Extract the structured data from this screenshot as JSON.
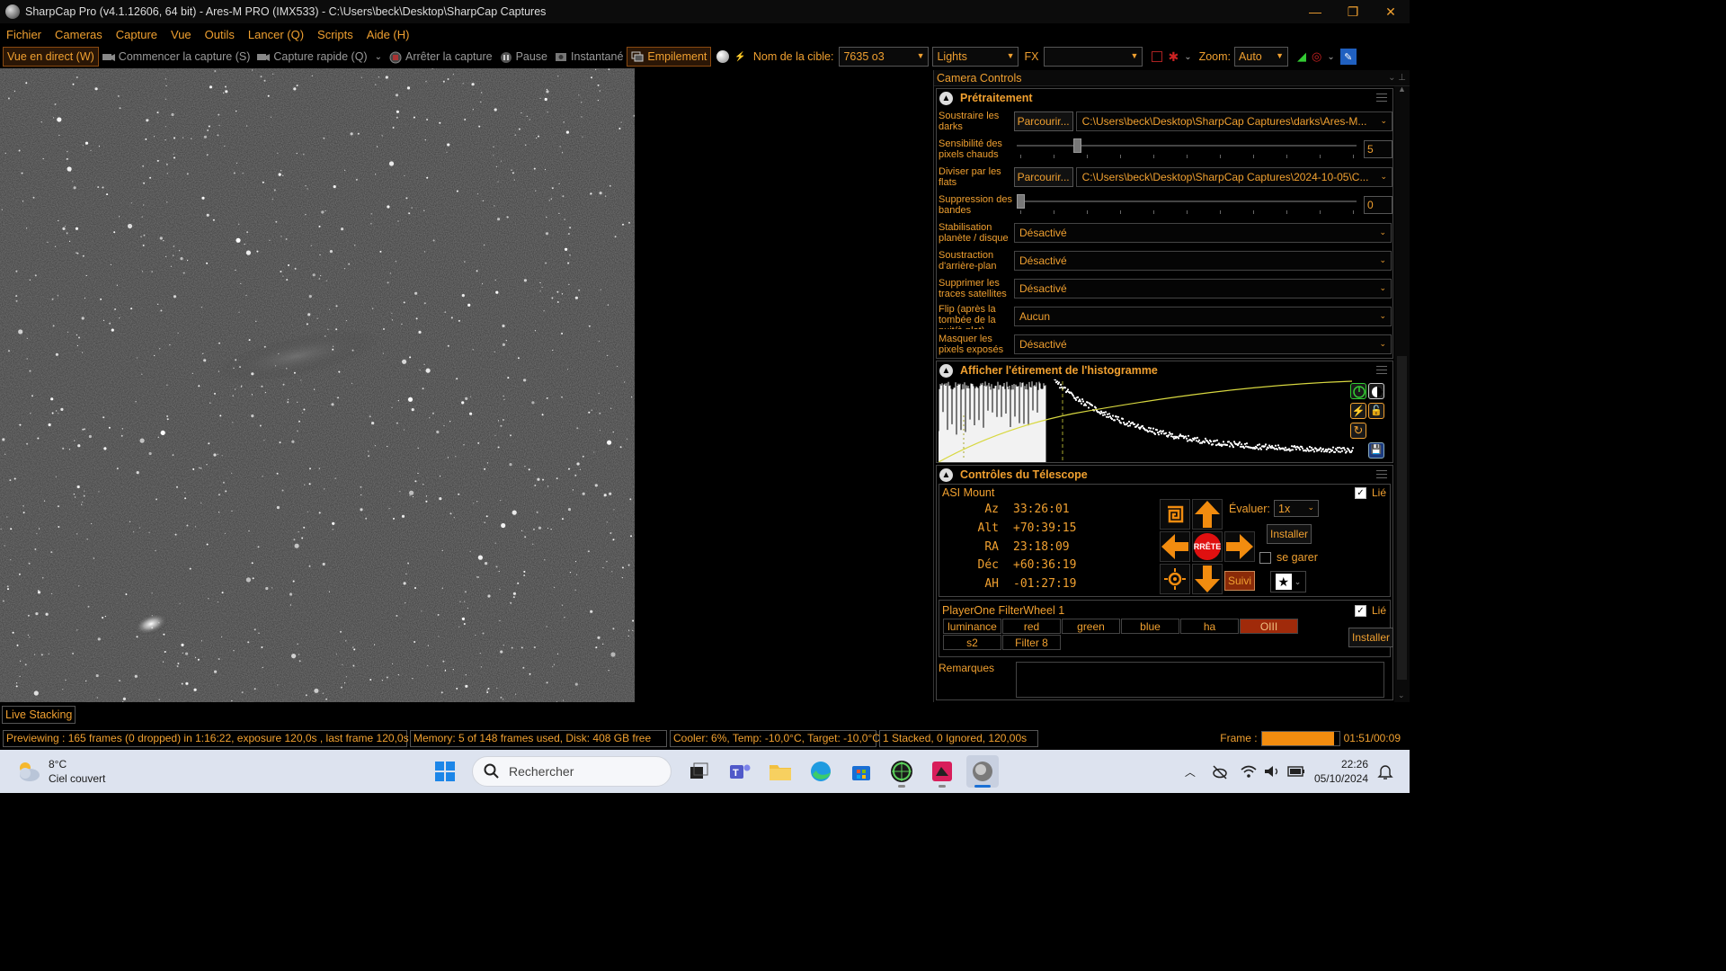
{
  "window": {
    "title": "SharpCap Pro (v4.1.12606, 64 bit) - Ares-M PRO (IMX533) - C:\\Users\\beck\\Desktop\\SharpCap Captures",
    "minimize": "—",
    "maximize": "❐",
    "close": "✕"
  },
  "menu": [
    "Fichier",
    "Cameras",
    "Capture",
    "Vue",
    "Outils",
    "Lancer (Q)",
    "Scripts",
    "Aide (H)"
  ],
  "toolbar": {
    "live_view": "Vue en direct (W)",
    "start_capture": "Commencer la capture (S)",
    "quick_capture": "Capture rapide (Q)",
    "stop_capture": "Arrêter la capture",
    "pause": "Pause",
    "snapshot": "Instantané",
    "stacking": "Empilement",
    "target_label": "Nom de la cible:",
    "target_value": "7635 o3",
    "frame_type": "Lights",
    "fx_label": "FX",
    "fx_value": "",
    "zoom_label": "Zoom:",
    "zoom_value": "Auto"
  },
  "panel": {
    "title": "Camera Controls",
    "preprocessing": {
      "title": "Prétraitement",
      "darks_label": "Soustraire les darks",
      "darks_button": "Parcourir...",
      "darks_path": "C:\\Users\\beck\\Desktop\\SharpCap Captures\\darks\\Ares-M...",
      "hotpix_label": "Sensibilité des pixels chauds",
      "hotpix_value": "5",
      "hotpix_level": 0.17,
      "flats_label": "Diviser par les flats",
      "flats_button": "Parcourir...",
      "flats_path": "C:\\Users\\beck\\Desktop\\SharpCap Captures\\2024-10-05\\C...",
      "banding_label": "Suppression des bandes",
      "banding_value": "0",
      "banding_level": 0.0,
      "stab_label": "Stabilisation planète / disque",
      "stab_value": "Désactivé",
      "bg_label": "Soustraction d'arrière-plan",
      "bg_value": "Désactivé",
      "sat_label": "Supprimer les traces satellites",
      "sat_value": "Désactivé",
      "flip_label": "Flip (après la tombée de la nuit/à plat)",
      "flip_value": "Aucun",
      "mask_label": "Masquer les pixels exposés",
      "mask_value": "Désactivé"
    },
    "histogram": {
      "title": "Afficher l'étirement de l'histogramme"
    },
    "telescope": {
      "title": "Contrôles du Télescope",
      "mount_name": "ASI Mount",
      "linked_label": "Lié",
      "coords": [
        {
          "k": "Az",
          "v": "33:26:01"
        },
        {
          "k": "Alt",
          "v": "+70:39:15"
        },
        {
          "k": "RA",
          "v": "23:18:09"
        },
        {
          "k": "Déc",
          "v": "+60:36:19"
        },
        {
          "k": "AH",
          "v": "-01:27:19"
        }
      ],
      "stop_label": "RRÊTE",
      "rate_label": "Évaluer:",
      "rate_value": "1x",
      "setup_button": "Installer",
      "park_label": "se garer",
      "track_button": "Suivi"
    },
    "filterwheel": {
      "name": "PlayerOne FilterWheel 1",
      "linked_label": "Lié",
      "filters": [
        "luminance",
        "red",
        "green",
        "blue",
        "ha",
        "OIII",
        "s2",
        "Filter 8"
      ],
      "selected": "OIII",
      "setup_button": "Installer"
    },
    "notes_label": "Remarques"
  },
  "live_stacking_tab": "Live Stacking",
  "status": {
    "preview": "Previewing : 165 frames (0 dropped) in 1:16:22, exposure 120,0s , last frame 120,0s",
    "memory": "Memory: 5 of 148 frames used, Disk: 408 GB free",
    "cooler": "Cooler: 6%, Temp: -10,0°C, Target: -10,0°C",
    "stack": "1 Stacked, 0 Ignored, 120,00s",
    "frame_label": "Frame :",
    "frame_time": "01:51/00:09",
    "frame_progress": 0.93
  },
  "taskbar": {
    "temp": "8°C",
    "weather": "Ciel couvert",
    "search": "Rechercher",
    "time": "22:26",
    "date": "05/10/2024"
  },
  "colors": {
    "accent": "#f0a030",
    "selected_filter": "#a02a0a",
    "arrow": "#f28c0f",
    "stop": "#e01010"
  }
}
